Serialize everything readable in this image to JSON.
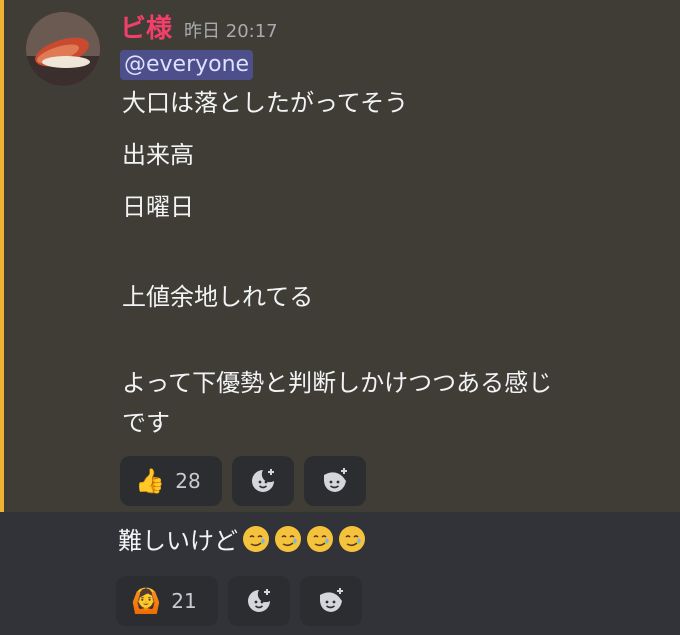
{
  "message1": {
    "username": "ビ様",
    "timestamp": "昨日 20:17",
    "mention": "@everyone",
    "lines": [
      "大口は落としたがってそう",
      "出来高",
      "日曜日",
      "上値余地しれてる",
      "よって下優勢と判断しかけつつある感じ",
      "です"
    ],
    "reactions": [
      {
        "emoji": "👍",
        "count": "28"
      },
      {
        "icon": "moon-add-icon"
      },
      {
        "icon": "face-moon-add-icon"
      }
    ],
    "accent_color": "#f0b232",
    "username_color": "#f23f6a"
  },
  "message2": {
    "text": "難しいけど",
    "trailing_emoji": [
      "🥲",
      "🥲",
      "🥲",
      "🥲"
    ],
    "reactions": [
      {
        "emoji": "🙆",
        "count": "21"
      },
      {
        "icon": "moon-add-icon"
      },
      {
        "icon": "face-moon-add-icon"
      }
    ]
  }
}
